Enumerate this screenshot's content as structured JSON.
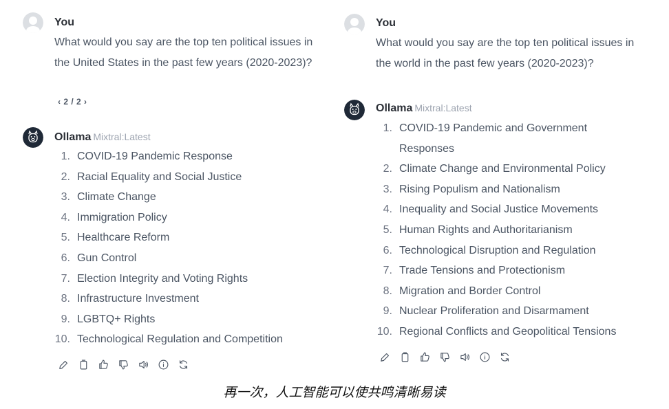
{
  "left": {
    "user": {
      "name": "You",
      "prompt": "What would you say are the top ten political issues in the United States in the past few years (2020-2023)?",
      "pager": {
        "prev": "‹",
        "label": "2 / 2",
        "next": "›"
      }
    },
    "assistant": {
      "name": "Ollama",
      "model": "Mixtral:Latest",
      "items": [
        "COVID-19 Pandemic Response",
        "Racial Equality and Social Justice",
        "Climate Change",
        "Immigration Policy",
        "Healthcare Reform",
        "Gun Control",
        "Election Integrity and Voting Rights",
        "Infrastructure Investment",
        "LGBTQ+ Rights",
        "Technological Regulation and Competition"
      ]
    },
    "actions": [
      "edit-icon",
      "copy-icon",
      "thumbs-up-icon",
      "thumbs-down-icon",
      "speaker-icon",
      "info-icon",
      "regenerate-icon"
    ]
  },
  "right": {
    "user": {
      "name": "You",
      "prompt": "What would you say are the top ten political issues in the world in the past few years (2020-2023)?"
    },
    "assistant": {
      "name": "Ollama",
      "model": "Mixtral:Latest",
      "items": [
        "COVID-19 Pandemic and Government Responses",
        "Climate Change and Environmental Policy",
        "Rising Populism and Nationalism",
        "Inequality and Social Justice Movements",
        "Human Rights and Authoritarianism",
        "Technological Disruption and Regulation",
        "Trade Tensions and Protectionism",
        "Migration and Border Control",
        "Nuclear Proliferation and Disarmament",
        "Regional Conflicts and Geopolitical Tensions"
      ]
    },
    "actions": [
      "edit-icon",
      "copy-icon",
      "thumbs-up-icon",
      "thumbs-down-icon",
      "speaker-icon",
      "info-icon",
      "regenerate-icon"
    ]
  },
  "caption": "再一次，人工智能可以使共鸣清晰易读",
  "colors": {
    "text": "#4b5563",
    "name": "#2b2f36",
    "muted": "#9ca3af",
    "avatar_user": "#d1d5db",
    "avatar_bot": "#1f2937"
  }
}
